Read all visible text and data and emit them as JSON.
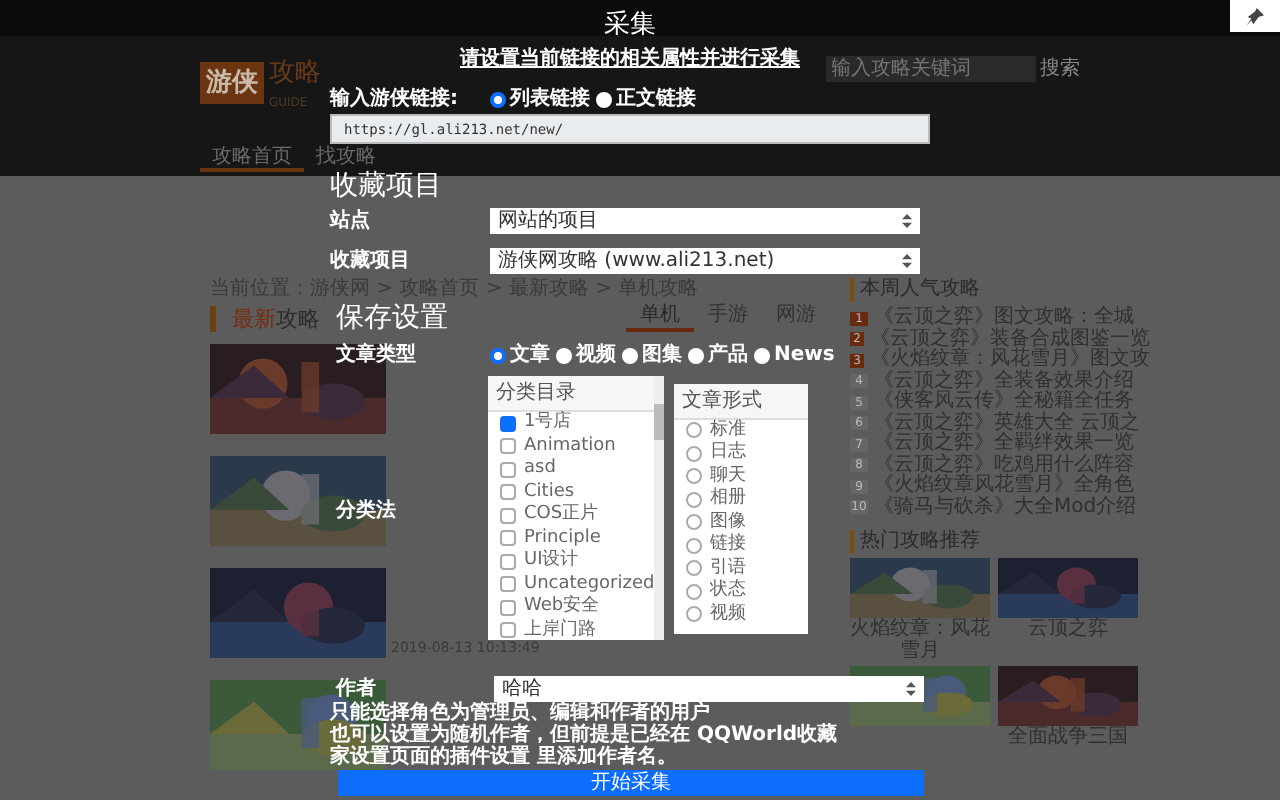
{
  "site": {
    "logo": "游侠",
    "logo_sub": "攻略",
    "logo_tag": "GUIDE",
    "search_placeholder": "输入攻略关键词",
    "search_button": "搜索",
    "nav": [
      {
        "label": "攻略首页",
        "selected": true
      },
      {
        "label": "找攻略",
        "selected": false
      }
    ],
    "breadcrumb": "当前位置：游侠网 > 攻略首页 > 最新攻略 > 单机攻略",
    "section_accent": "最新",
    "section_title": "攻略",
    "tabs": [
      {
        "label": "单机",
        "selected": true
      },
      {
        "label": "手游",
        "selected": false
      },
      {
        "label": "网游",
        "selected": false
      }
    ],
    "articles": [
      {
        "kind": "picture"
      },
      {
        "kind": "picture"
      },
      {
        "kind": "picture",
        "date": "2019-08-13 10:13:49"
      },
      {
        "kind": "picture"
      }
    ],
    "weekly_title": "本周人气攻略",
    "weekly": [
      {
        "rank": "1",
        "title": "《云顶之弈》图文攻略：全城"
      },
      {
        "rank": "2",
        "title": "《云顶之弈》装备合成图鉴一览"
      },
      {
        "rank": "3",
        "title": "《火焰纹章：风花雪月》图文攻"
      },
      {
        "rank": "4",
        "title": "《云顶之弈》全装备效果介绍"
      },
      {
        "rank": "5",
        "title": "《侠客风云传》全秘籍全任务"
      },
      {
        "rank": "6",
        "title": "《云顶之弈》英雄大全 云顶之"
      },
      {
        "rank": "7",
        "title": "《云顶之弈》全羁绊效果一览"
      },
      {
        "rank": "8",
        "title": "《云顶之弈》吃鸡用什么阵容"
      },
      {
        "rank": "9",
        "title": "《火焰纹章风花雪月》全角色"
      },
      {
        "rank": "10",
        "title": "《骑马与砍杀》大全Mod介绍"
      }
    ],
    "hot_title": "热门攻略推荐",
    "hot": [
      {
        "kind": "picture",
        "caption": "火焰纹章：风花雪月"
      },
      {
        "kind": "picture",
        "caption": "云顶之弈"
      },
      {
        "kind": "picture"
      },
      {
        "kind": "picture",
        "caption": "全面战争三国"
      }
    ]
  },
  "modal": {
    "title": "采集",
    "subtitle": "请设置当前链接的相关属性并进行采集",
    "link_label": "输入游侠链接:",
    "link_types": [
      {
        "label": "列表链接",
        "selected": true
      },
      {
        "label": "正文链接",
        "selected": false
      }
    ],
    "url": "https://gl.ali213.net/new/",
    "favorites_heading": "收藏项目",
    "site_label": "站点",
    "site_value": "网站的项目",
    "project_label": "收藏项目",
    "project_value": "游侠网攻略 (www.ali213.net)",
    "save_heading": "保存设置",
    "type_label": "文章类型",
    "post_types": [
      {
        "label": "文章",
        "selected": true
      },
      {
        "label": "视频",
        "selected": false
      },
      {
        "label": "图集",
        "selected": false
      },
      {
        "label": "产品",
        "selected": false
      },
      {
        "label": "News",
        "selected": false
      }
    ],
    "taxonomy_label": "分类法",
    "categories_title": "分类目录",
    "categories": [
      {
        "label": "1号店",
        "checked": true
      },
      {
        "label": "Animation",
        "checked": false
      },
      {
        "label": "asd",
        "checked": false
      },
      {
        "label": "Cities",
        "checked": false
      },
      {
        "label": "COS正片",
        "checked": false
      },
      {
        "label": "Principle",
        "checked": false
      },
      {
        "label": "UI设计",
        "checked": false
      },
      {
        "label": "Uncategorized",
        "checked": false
      },
      {
        "label": "Web安全",
        "checked": false
      },
      {
        "label": "上岸门路",
        "checked": false
      }
    ],
    "formats_title": "文章形式",
    "formats": [
      {
        "label": "标准",
        "selected": false
      },
      {
        "label": "日志",
        "selected": false
      },
      {
        "label": "聊天",
        "selected": false
      },
      {
        "label": "相册",
        "selected": false
      },
      {
        "label": "图像",
        "selected": false
      },
      {
        "label": "链接",
        "selected": false
      },
      {
        "label": "引语",
        "selected": false
      },
      {
        "label": "状态",
        "selected": false
      },
      {
        "label": "视频",
        "selected": false
      }
    ],
    "author_label": "作者",
    "author_value": "哈哈",
    "notes": [
      "只能选择角色为管理员、编辑和作者的用户",
      "也可以设置为随机作者，但前提是已经在 QQWorld收藏家设置页面的插件设置 里添加作者名。"
    ],
    "submit": "开始采集"
  }
}
